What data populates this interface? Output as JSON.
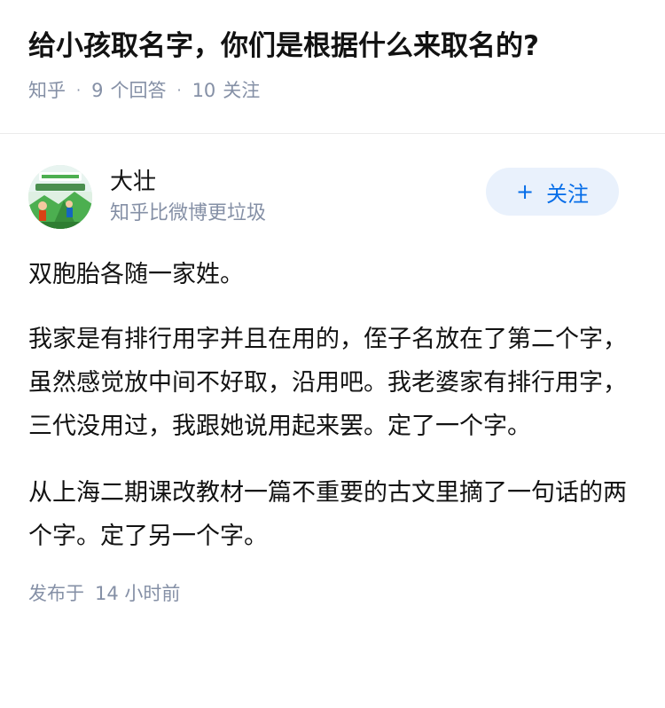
{
  "question": {
    "title": "给小孩取名字，你们是根据什么来取名的?",
    "source": "知乎",
    "answers_count": "9",
    "answers_label": "个回答",
    "followers_count": "10",
    "followers_label": "关注"
  },
  "answer": {
    "author": {
      "name": "大壮",
      "bio": "知乎比微博更垃圾",
      "avatar_icon": "avatar-illustration",
      "follow_plus": "+",
      "follow_label": "关注"
    },
    "paragraphs": [
      "双胞胎各随一家姓。",
      "我家是有排行用字并且在用的，侄子名放在了第二个字，虽然感觉放中间不好取，沿用吧。我老婆家有排行用字，三代没用过，我跟她说用起来罢。定了一个字。",
      "从上海二期课改教材一篇不重要的古文里摘了一句话的两个字。定了另一个字。"
    ],
    "published_label": "发布于",
    "published_time": "14 小时前"
  },
  "colors": {
    "accent": "#056de8",
    "follow_bg": "#e9f1fc",
    "meta_gray": "#8590a6",
    "text": "#121212"
  }
}
